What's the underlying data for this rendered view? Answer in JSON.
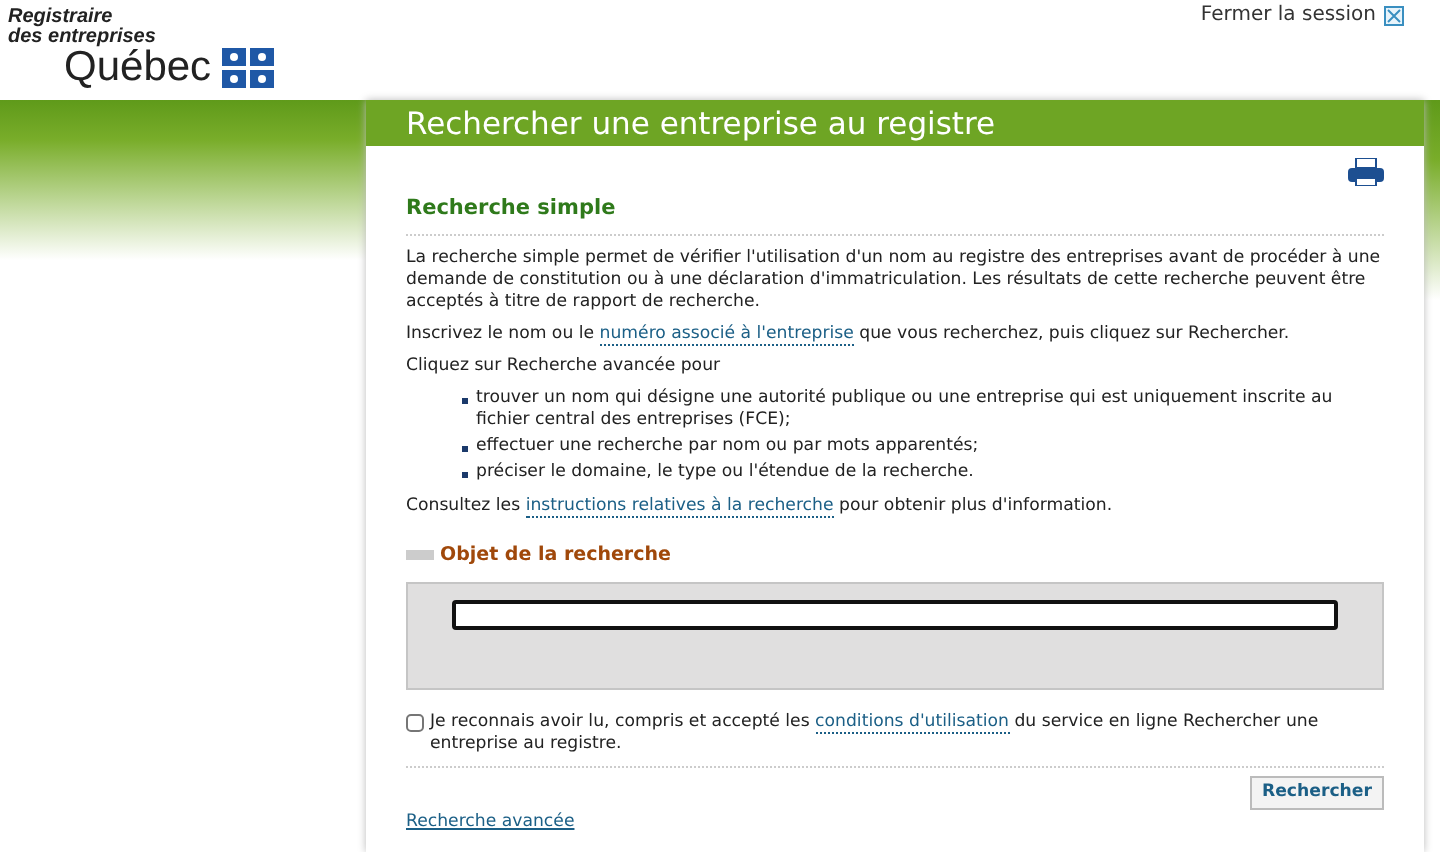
{
  "header": {
    "logo_line_1": "Registraire",
    "logo_line_2": "des entreprises",
    "logo_name": "Québec",
    "logout": "Fermer la session"
  },
  "page_title": "Rechercher une entreprise au registre",
  "section_title": "Recherche simple",
  "intro": "La recherche simple permet de vérifier l'utilisation d'un nom au registre des entreprises avant de procéder à une demande de constitution ou à une déclaration d'immatriculation. Les résultats de cette recherche peuvent être acceptés à titre de rapport de recherche.",
  "instruction": {
    "before": "Inscrivez le nom ou le ",
    "link": "numéro associé à l'entreprise",
    "after": " que vous recherchez, puis cliquez sur Rechercher."
  },
  "advanced_intro": "Cliquez sur Recherche avancée pour",
  "advanced_items": [
    "trouver un nom qui désigne une autorité publique ou une entreprise qui est uniquement inscrite au fichier central des entreprises (FCE);",
    "effectuer une recherche par nom ou par mots apparentés;",
    "préciser le domaine, le type ou l'étendue de la recherche."
  ],
  "consult": {
    "before": "Consultez les ",
    "link": "instructions relatives à la recherche",
    "after": " pour obtenir plus d'information."
  },
  "search_object": {
    "title": "Objet de la recherche"
  },
  "terms": {
    "checked": false,
    "before": "Je reconnais avoir lu, compris et accepté les ",
    "link": "conditions d'utilisation",
    "after": " du service en ligne Rechercher une entreprise au registre."
  },
  "search_button": "Rechercher",
  "advanced_link": "Recherche avancée"
}
